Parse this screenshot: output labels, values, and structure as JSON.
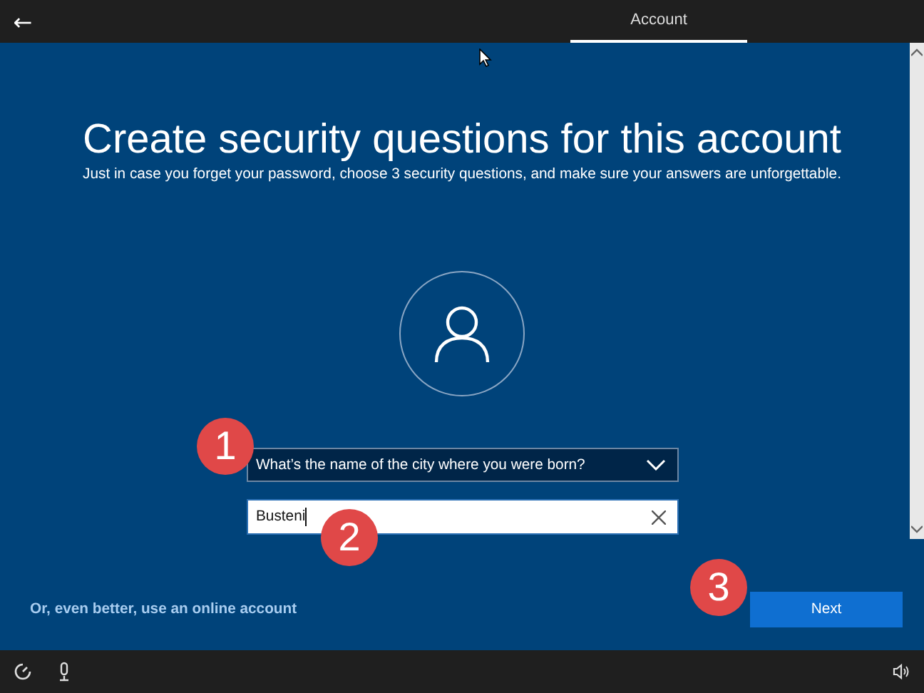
{
  "header": {
    "back_button": "←",
    "tabs": [
      {
        "label": "Account",
        "selected": true
      }
    ]
  },
  "title": "Create security questions for this account",
  "subtitle": "Just in case you forget your password, choose 3 security questions, and make sure your answers are unforgettable.",
  "question_dropdown": {
    "value": "What’s the name of the city where you were born?"
  },
  "answer_field": {
    "value": "Busteni",
    "focused": true
  },
  "online_account_link": "Or, even better, use an online account",
  "next_button": "Next",
  "callouts": [
    "1",
    "2",
    "3"
  ]
}
